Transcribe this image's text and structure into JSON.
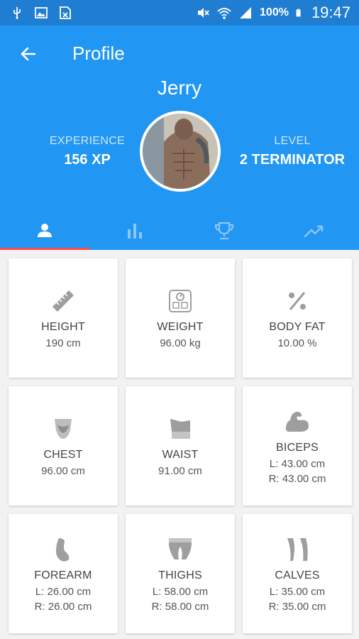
{
  "status_bar": {
    "battery": "100%",
    "time": "19:47"
  },
  "header": {
    "title": "Profile",
    "user_name": "Jerry",
    "experience": {
      "label": "EXPERIENCE",
      "value": "156 XP"
    },
    "level": {
      "label": "LEVEL",
      "value": "2 TERMINATOR"
    }
  },
  "tabs": [
    {
      "icon": "person-icon",
      "active": true
    },
    {
      "icon": "bar-chart-icon",
      "active": false
    },
    {
      "icon": "trophy-icon",
      "active": false
    },
    {
      "icon": "trending-up-icon",
      "active": false
    }
  ],
  "measurements": {
    "height": {
      "label": "HEIGHT",
      "value": "190 cm"
    },
    "weight": {
      "label": "WEIGHT",
      "value": "96.00 kg"
    },
    "body_fat": {
      "label": "BODY FAT",
      "value": "10.00 %"
    },
    "chest": {
      "label": "CHEST",
      "value": "96.00 cm"
    },
    "waist": {
      "label": "WAIST",
      "value": "91.00 cm"
    },
    "biceps": {
      "label": "BICEPS",
      "left": "L: 43.00 cm",
      "right": "R: 43.00 cm"
    },
    "forearm": {
      "label": "FOREARM",
      "left": "L: 26.00 cm",
      "right": "R: 26.00 cm"
    },
    "thighs": {
      "label": "THIGHS",
      "left": "L: 58.00 cm",
      "right": "R: 58.00 cm"
    },
    "calves": {
      "label": "CALVES",
      "left": "L: 35.00 cm",
      "right": "R: 35.00 cm"
    }
  },
  "colors": {
    "status_bar": "#1f7ed1",
    "header": "#2196f3",
    "tab_indicator": "#ff4d4d",
    "icon_gray": "#9e9e9e"
  }
}
